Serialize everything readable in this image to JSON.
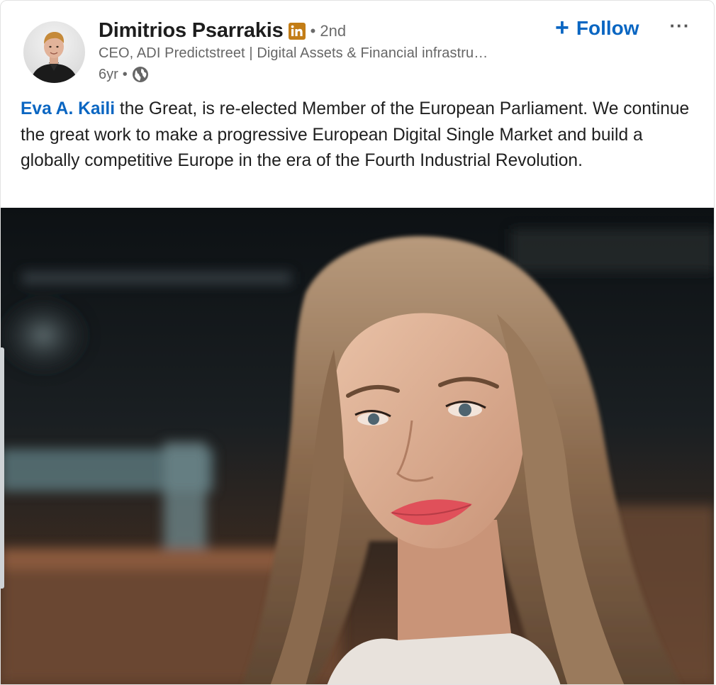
{
  "author": {
    "name": "Dimitrios Psarrakis",
    "badge_icon": "linkedin-icon",
    "degree": "• 2nd",
    "headline": "CEO, ADI Predictstreet | Digital Assets & Financial infrastru…",
    "time": "6yr",
    "meta_separator": "•",
    "visibility_icon": "globe-icon"
  },
  "actions": {
    "follow_plus": "+",
    "follow_label": "Follow",
    "more_label": "···"
  },
  "post": {
    "mention": "Eva A. Kaili",
    "body": " the Great, is re-elected Member of the European Parliament. We continue the great work to make a progressive European Digital Single Market and build a globally competitive Europe in the era of the Fourth Industrial Revolution."
  },
  "colors": {
    "link_blue": "#0a66c2",
    "linkedin_badge": "#c37d16"
  }
}
